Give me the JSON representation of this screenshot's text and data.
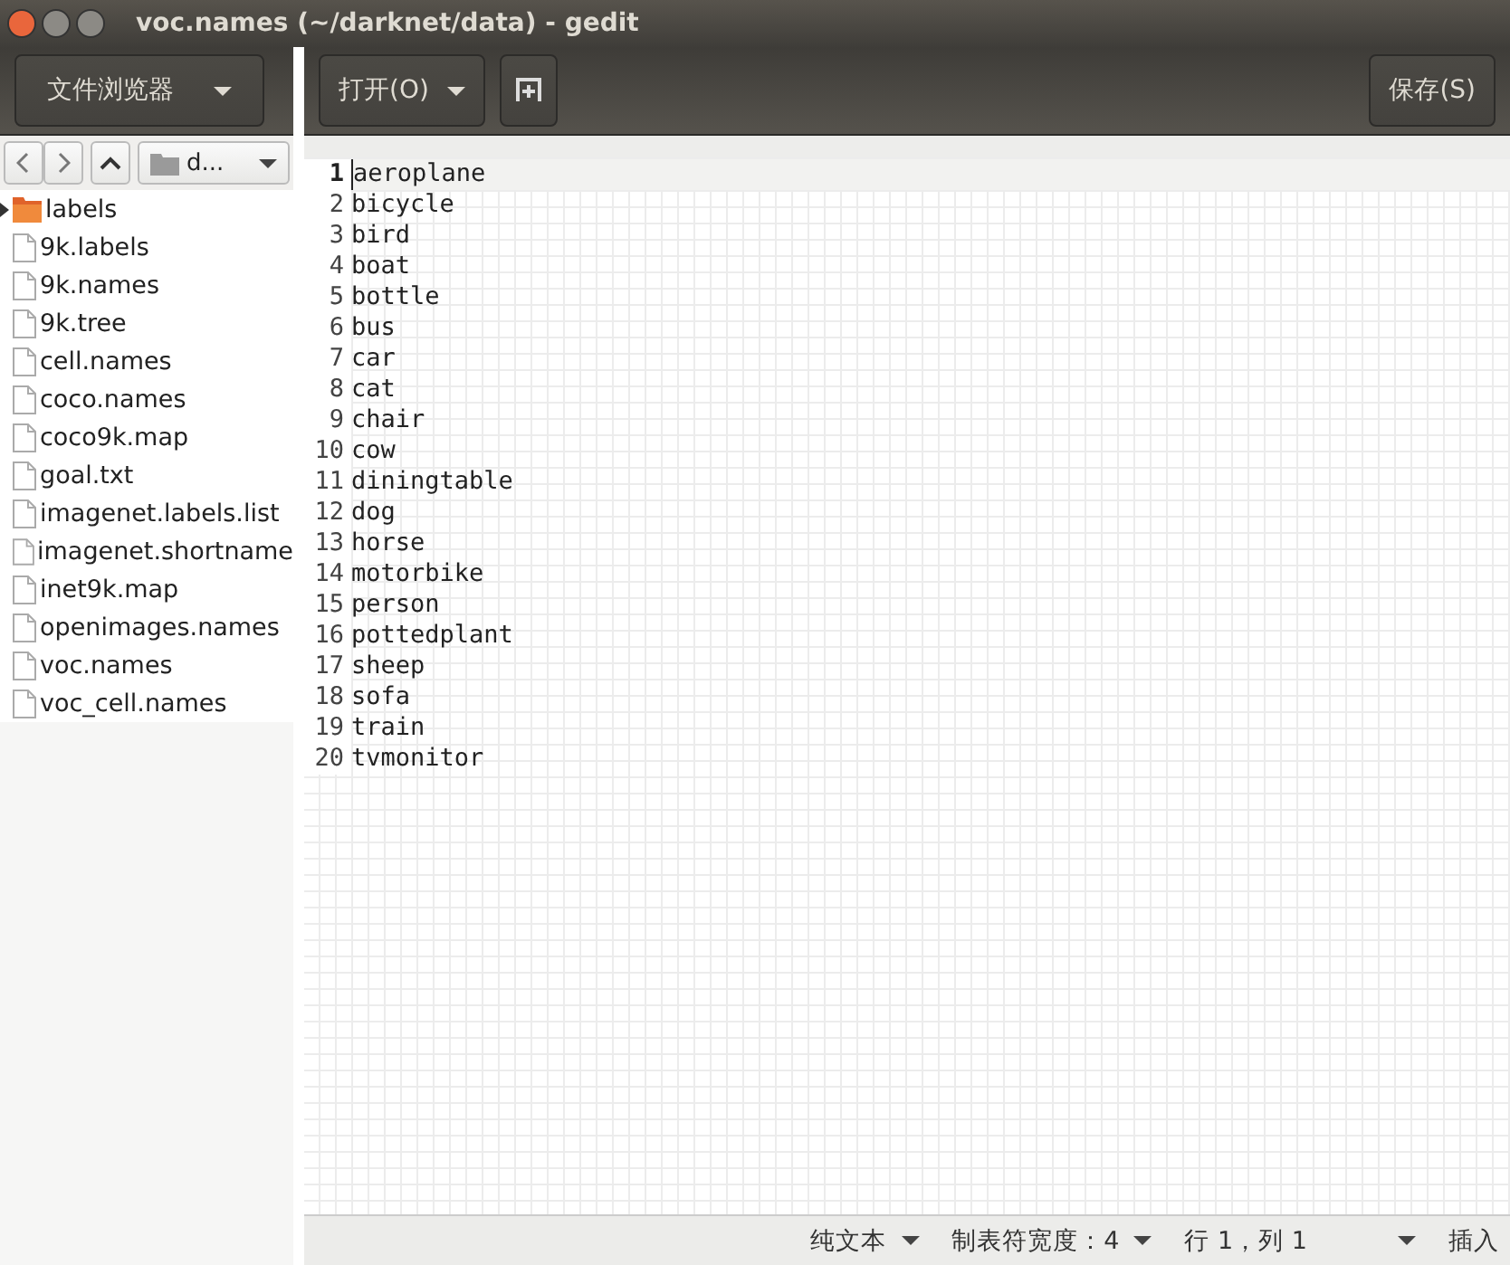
{
  "window": {
    "title": "voc.names (~/darknet/data) - gedit"
  },
  "sidebar": {
    "mode_button": "文件浏览器",
    "location": "d...",
    "items": [
      {
        "name": "labels",
        "kind": "folder",
        "expanded": false
      },
      {
        "name": "9k.labels",
        "kind": "file"
      },
      {
        "name": "9k.names",
        "kind": "file"
      },
      {
        "name": "9k.tree",
        "kind": "file"
      },
      {
        "name": "cell.names",
        "kind": "file"
      },
      {
        "name": "coco.names",
        "kind": "file"
      },
      {
        "name": "coco9k.map",
        "kind": "file"
      },
      {
        "name": "goal.txt",
        "kind": "file"
      },
      {
        "name": "imagenet.labels.list",
        "kind": "file"
      },
      {
        "name": "imagenet.shortname",
        "kind": "file"
      },
      {
        "name": "inet9k.map",
        "kind": "file"
      },
      {
        "name": "openimages.names",
        "kind": "file"
      },
      {
        "name": "voc.names",
        "kind": "file"
      },
      {
        "name": "voc_cell.names",
        "kind": "file"
      }
    ]
  },
  "toolbar": {
    "open_button": "打开(O)",
    "save_button": "保存(S)"
  },
  "editor": {
    "lines": [
      {
        "number": "1",
        "text": "aeroplane",
        "current": true
      },
      {
        "number": "2",
        "text": "bicycle",
        "current": false
      },
      {
        "number": "3",
        "text": "bird",
        "current": false
      },
      {
        "number": "4",
        "text": "boat",
        "current": false
      },
      {
        "number": "5",
        "text": "bottle",
        "current": false
      },
      {
        "number": "6",
        "text": "bus",
        "current": false
      },
      {
        "number": "7",
        "text": "car",
        "current": false
      },
      {
        "number": "8",
        "text": "cat",
        "current": false
      },
      {
        "number": "9",
        "text": "chair",
        "current": false
      },
      {
        "number": "10",
        "text": "cow",
        "current": false
      },
      {
        "number": "11",
        "text": "diningtable",
        "current": false
      },
      {
        "number": "12",
        "text": "dog",
        "current": false
      },
      {
        "number": "13",
        "text": "horse",
        "current": false
      },
      {
        "number": "14",
        "text": "motorbike",
        "current": false
      },
      {
        "number": "15",
        "text": "person",
        "current": false
      },
      {
        "number": "16",
        "text": "pottedplant",
        "current": false
      },
      {
        "number": "17",
        "text": "sheep",
        "current": false
      },
      {
        "number": "18",
        "text": "sofa",
        "current": false
      },
      {
        "number": "19",
        "text": "train",
        "current": false
      },
      {
        "number": "20",
        "text": "tvmonitor",
        "current": false
      }
    ]
  },
  "status_bar": {
    "language": "纯文本",
    "tab_width": "制表符宽度：4",
    "position": "行 1，列 1",
    "mode": "插入"
  }
}
